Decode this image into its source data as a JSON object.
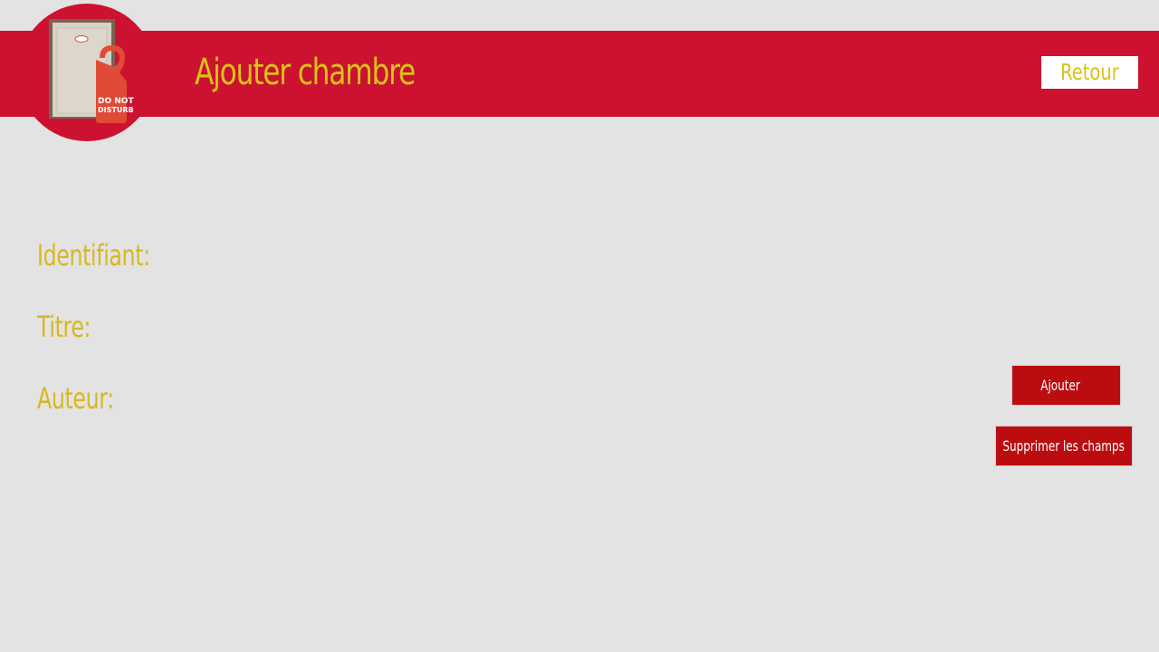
{
  "colors": {
    "background": "#e3e3e3",
    "header": "#cc1230",
    "title_text": "#d9c21a",
    "label_text": "#d6b91e",
    "button_bg": "#bb0d10",
    "button_text": "#ffffff"
  },
  "header": {
    "title": "Ajouter chambre",
    "back_label": "Retour",
    "logo_icon": "door-do-not-disturb-icon",
    "logo_text": "DO NOT DISTURB"
  },
  "form": {
    "labels": [
      "Identifiant:",
      "Titre:",
      "Auteur:"
    ]
  },
  "actions": {
    "add_label": "Ajouter",
    "clear_label": "Supprimer les champs"
  }
}
